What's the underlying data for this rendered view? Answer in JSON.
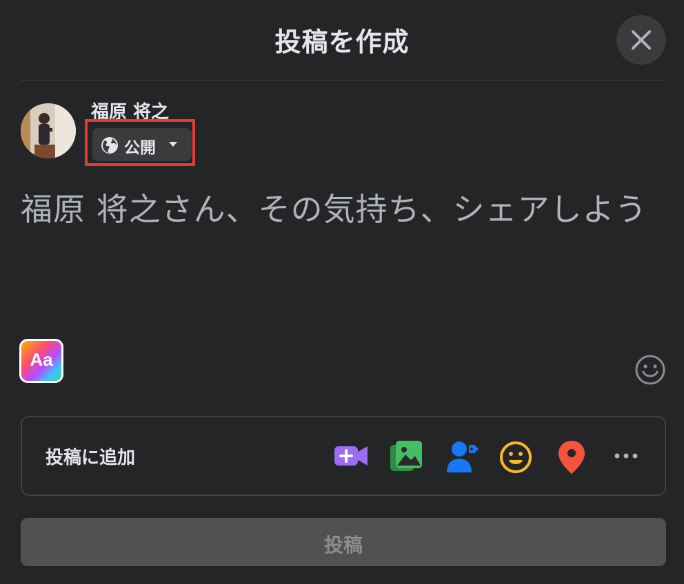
{
  "dialog": {
    "title": "投稿を作成",
    "close_icon": "close-icon"
  },
  "user": {
    "name": "福原 将之",
    "avatar_icon": "avatar-photo"
  },
  "privacy": {
    "label": "公開",
    "icon": "globe-icon",
    "dropdown_icon": "caret-down-icon",
    "highlight_color": "#e63a2e"
  },
  "composer": {
    "placeholder": "福原 将之さん、その気持ち、シェアしよう"
  },
  "add_to_post": {
    "label": "投稿に追加",
    "icons": [
      {
        "name": "live-video-icon",
        "color": "#9b6cf4"
      },
      {
        "name": "photo-video-icon",
        "color": "#45bd62"
      },
      {
        "name": "tag-people-icon",
        "color": "#1877f2"
      },
      {
        "name": "feeling-activity-icon",
        "color": "#f7b928"
      },
      {
        "name": "check-in-icon",
        "color": "#f5533d"
      },
      {
        "name": "more-icon",
        "color": "#b0b3b8"
      }
    ]
  },
  "post_button": {
    "label": "投稿"
  },
  "theme": {
    "background": "#242526",
    "surface": "#3a3b3c",
    "text": "#e4e6eb",
    "secondary_text": "#b0b3b8"
  }
}
